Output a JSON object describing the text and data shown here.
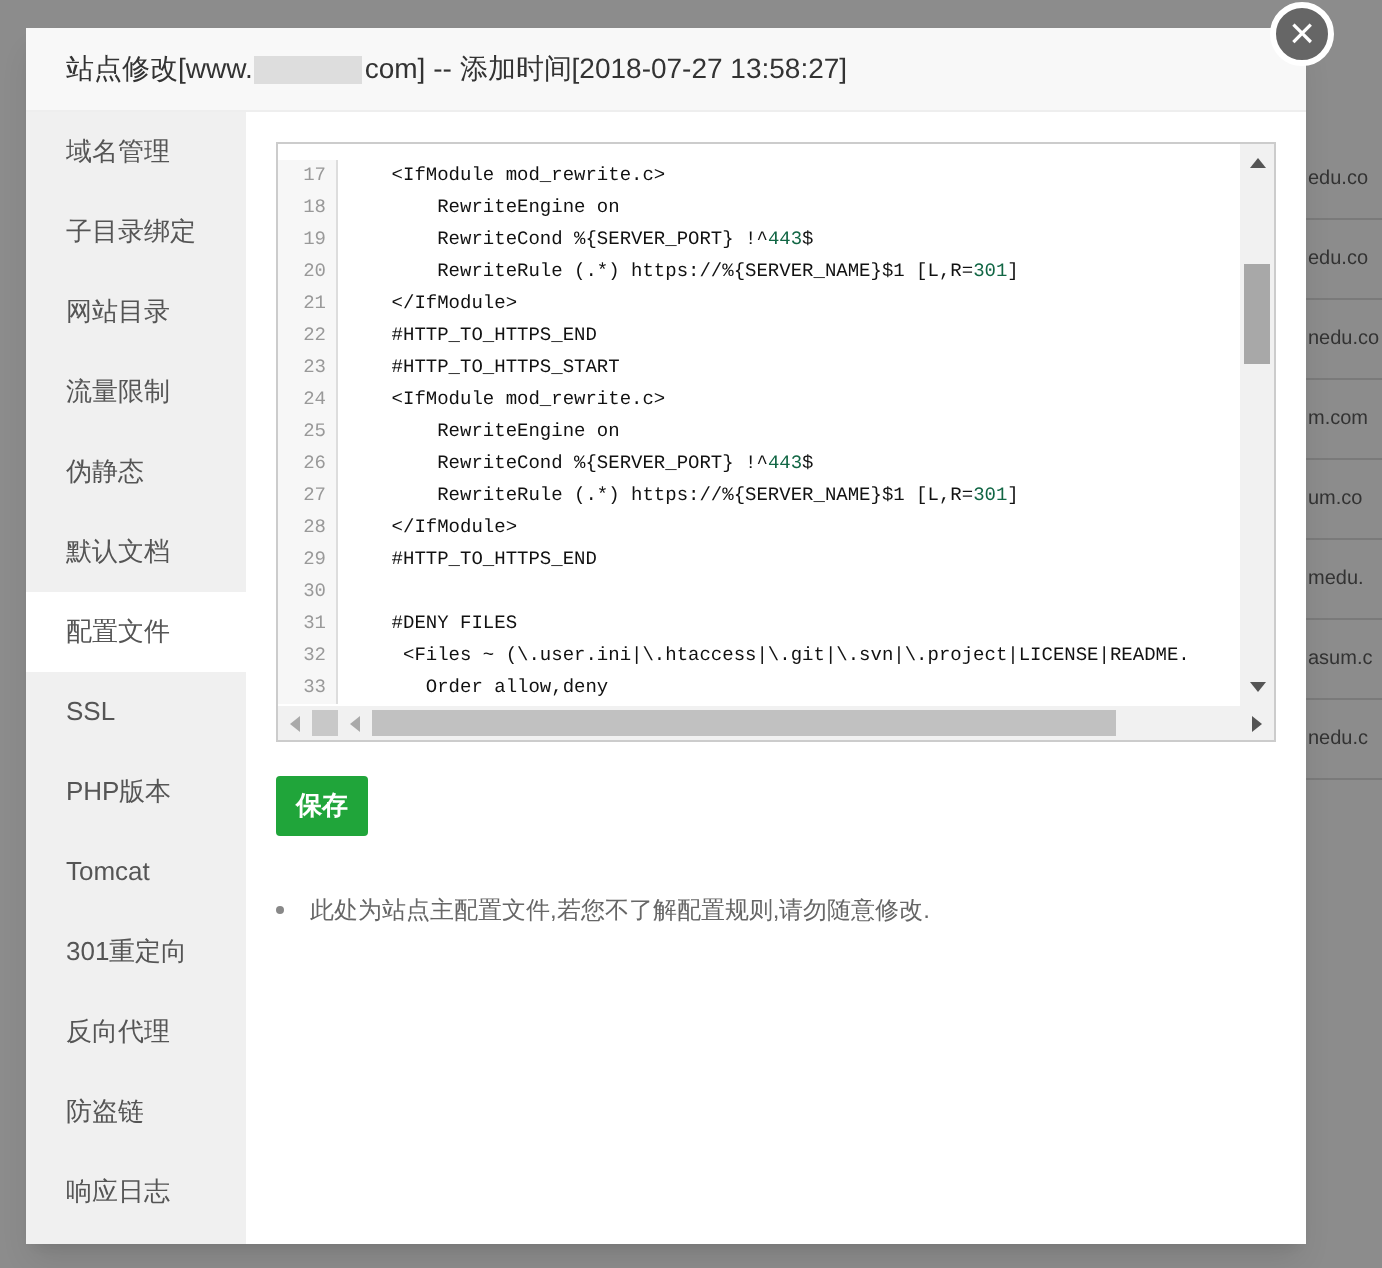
{
  "backdrop": {
    "rows": [
      "edu.co",
      "edu.co",
      "nedu.co",
      "m.com",
      "um.co",
      "medu.",
      "asum.c",
      "nedu.c"
    ]
  },
  "dialog": {
    "title": "站点修改[www.",
    "title_end": "com] -- 添加时间[2018-07-27 13:58:27]",
    "close": "×"
  },
  "sidebar": {
    "items": [
      {
        "label": "域名管理",
        "selected": false
      },
      {
        "label": "子目录绑定",
        "selected": false
      },
      {
        "label": "网站目录",
        "selected": false
      },
      {
        "label": "流量限制",
        "selected": false
      },
      {
        "label": "伪静态",
        "selected": false
      },
      {
        "label": "默认文档",
        "selected": false
      },
      {
        "label": "配置文件",
        "selected": true
      },
      {
        "label": "SSL",
        "selected": false
      },
      {
        "label": "PHP版本",
        "selected": false
      },
      {
        "label": "Tomcat",
        "selected": false
      },
      {
        "label": "301重定向",
        "selected": false
      },
      {
        "label": "反向代理",
        "selected": false
      },
      {
        "label": "防盗链",
        "selected": false
      },
      {
        "label": "响应日志",
        "selected": false
      }
    ]
  },
  "editor": {
    "lines": [
      {
        "number": "17",
        "parts": [
          {
            "kind": "text",
            "text": "    <IfModule mod_rewrite.c>"
          }
        ]
      },
      {
        "number": "18",
        "parts": [
          {
            "kind": "text",
            "text": "        RewriteEngine on"
          }
        ]
      },
      {
        "number": "19",
        "parts": [
          {
            "kind": "text",
            "text": "        RewriteCond %{SERVER_PORT} !^"
          },
          {
            "kind": "number",
            "text": "443"
          },
          {
            "kind": "text",
            "text": "$"
          }
        ]
      },
      {
        "number": "20",
        "parts": [
          {
            "kind": "text",
            "text": "        RewriteRule (.*) https://%{SERVER_NAME}$1 [L,R="
          },
          {
            "kind": "number",
            "text": "301"
          },
          {
            "kind": "text",
            "text": "]"
          }
        ]
      },
      {
        "number": "21",
        "parts": [
          {
            "kind": "text",
            "text": "    </IfModule>"
          }
        ]
      },
      {
        "number": "22",
        "parts": [
          {
            "kind": "text",
            "text": "    #HTTP_TO_HTTPS_END"
          }
        ]
      },
      {
        "number": "23",
        "parts": [
          {
            "kind": "text",
            "text": "    #HTTP_TO_HTTPS_START"
          }
        ]
      },
      {
        "number": "24",
        "parts": [
          {
            "kind": "text",
            "text": "    <IfModule mod_rewrite.c>"
          }
        ]
      },
      {
        "number": "25",
        "parts": [
          {
            "kind": "text",
            "text": "        RewriteEngine on"
          }
        ]
      },
      {
        "number": "26",
        "parts": [
          {
            "kind": "text",
            "text": "        RewriteCond %{SERVER_PORT} !^"
          },
          {
            "kind": "number",
            "text": "443"
          },
          {
            "kind": "text",
            "text": "$"
          }
        ]
      },
      {
        "number": "27",
        "parts": [
          {
            "kind": "text",
            "text": "        RewriteRule (.*) https://%{SERVER_NAME}$1 [L,R="
          },
          {
            "kind": "number",
            "text": "301"
          },
          {
            "kind": "text",
            "text": "]"
          }
        ]
      },
      {
        "number": "28",
        "parts": [
          {
            "kind": "text",
            "text": "    </IfModule>"
          }
        ]
      },
      {
        "number": "29",
        "parts": [
          {
            "kind": "text",
            "text": "    #HTTP_TO_HTTPS_END"
          }
        ]
      },
      {
        "number": "30"
      },
      {
        "number": "31",
        "parts": [
          {
            "kind": "text",
            "text": "    #DENY FILES"
          }
        ]
      },
      {
        "number": "32",
        "parts": [
          {
            "kind": "text",
            "text": "     <Files ~ (\\.user.ini|\\.htaccess|\\.git|\\.svn|\\.project|LICENSE|README."
          }
        ]
      },
      {
        "number": "33",
        "parts": [
          {
            "kind": "text",
            "text": "       Order allow,deny"
          }
        ]
      }
    ]
  },
  "save_button": "保存",
  "notes": [
    "此处为站点主配置文件,若您不了解配置规则,请勿随意修改."
  ]
}
